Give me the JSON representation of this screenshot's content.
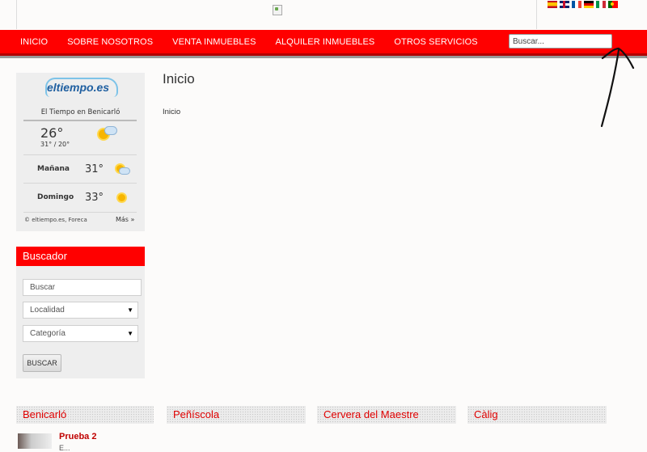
{
  "header": {
    "flags": [
      "es-flag-icon",
      "en-flag-icon",
      "fr-flag-icon",
      "de-flag-icon",
      "it-flag-icon",
      "pt-flag-icon"
    ]
  },
  "nav": {
    "items": [
      "INICIO",
      "SOBRE NOSOTROS",
      "VENTA INMUEBLES",
      "ALQUILER INMUEBLES",
      "OTROS SERVICIOS"
    ],
    "search_placeholder": "Buscar..."
  },
  "weather": {
    "logo_text": "eltiempo.es",
    "city": "El Tiempo en Benicarló",
    "now": {
      "temp": "26",
      "range": "31° / 20°"
    },
    "days": [
      {
        "label": "Mañana",
        "temp": "31"
      },
      {
        "label": "Domingo",
        "temp": "33"
      }
    ],
    "credit": "© eltiempo.es, Foreca",
    "more": "Más »"
  },
  "buscador": {
    "title": "Buscador",
    "search_value": "Buscar",
    "locality_value": "Localidad",
    "category_value": "Categoría",
    "button_label": "BUSCAR"
  },
  "main": {
    "title": "Inicio",
    "breadcrumb": "Inicio"
  },
  "categories": [
    "Benicarló",
    "Peñíscola",
    "Cervera del Maestre",
    "Càlig"
  ],
  "listing": {
    "title": "Prueba 2",
    "subtitle": "E..."
  },
  "colors": {
    "brand_red": "#ff0000",
    "dark_red": "#b30000"
  }
}
